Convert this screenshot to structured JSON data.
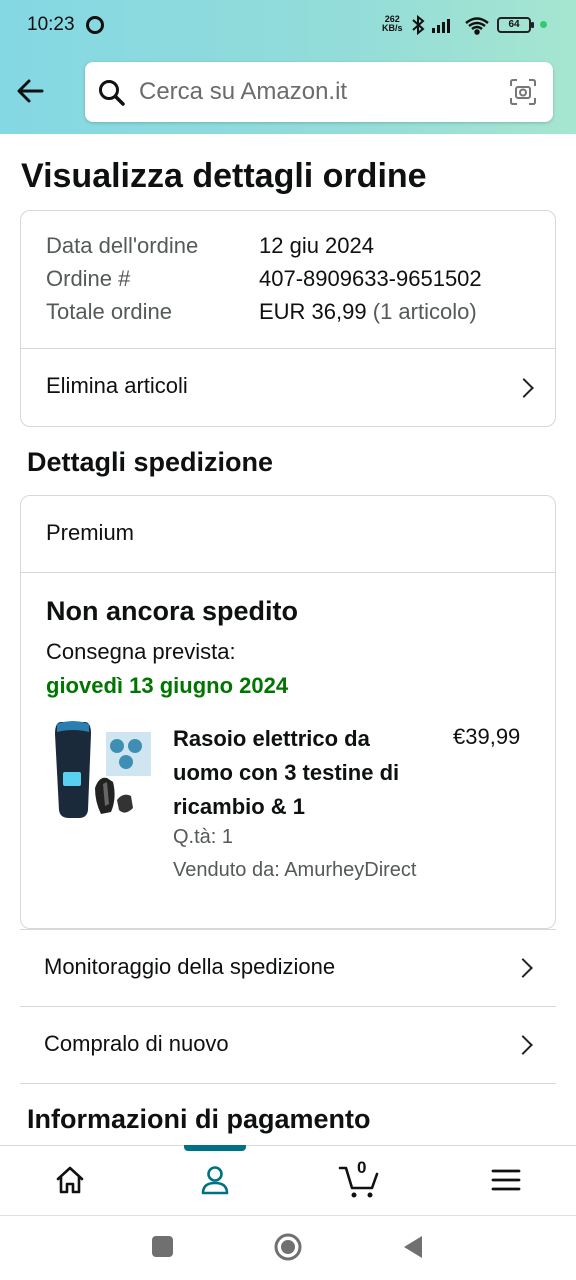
{
  "status_bar": {
    "time": "10:23",
    "net_speed_value": "262",
    "net_speed_unit": "KB/s",
    "battery": "64"
  },
  "search": {
    "placeholder": "Cerca su Amazon.it"
  },
  "page": {
    "title": "Visualizza dettagli ordine"
  },
  "order_summary": {
    "date_label": "Data dell'ordine",
    "date_value": "12 giu 2024",
    "number_label": "Ordine #",
    "number_value": "407-8909633-9651502",
    "total_label": "Totale ordine",
    "total_value": "EUR 36,99",
    "total_items": "(1 articolo)",
    "delete_items": "Elimina articoli"
  },
  "shipping": {
    "section_title": "Dettagli spedizione",
    "tier": "Premium",
    "status": "Non ancora spedito",
    "delivery_label": "Consegna prevista:",
    "delivery_date": "giovedì 13 giugno 2024",
    "product": {
      "title": "Rasoio elettrico da uomo con 3 testine di ricambio & 1",
      "price": "€39,99",
      "quantity": "Q.tà: 1",
      "seller": "Venduto da: AmurheyDirect"
    }
  },
  "actions": {
    "track": "Monitoraggio della spedizione",
    "buy_again": "Compralo di nuovo"
  },
  "payment": {
    "section_title": "Informazioni di pagamento"
  },
  "bottom_nav": {
    "cart_count": "0",
    "active": "account"
  },
  "colors": {
    "header_gradient_start": "#84d8e3",
    "header_gradient_end": "#a6e6d0",
    "delivery_green": "#007600",
    "active_teal": "#007185"
  }
}
